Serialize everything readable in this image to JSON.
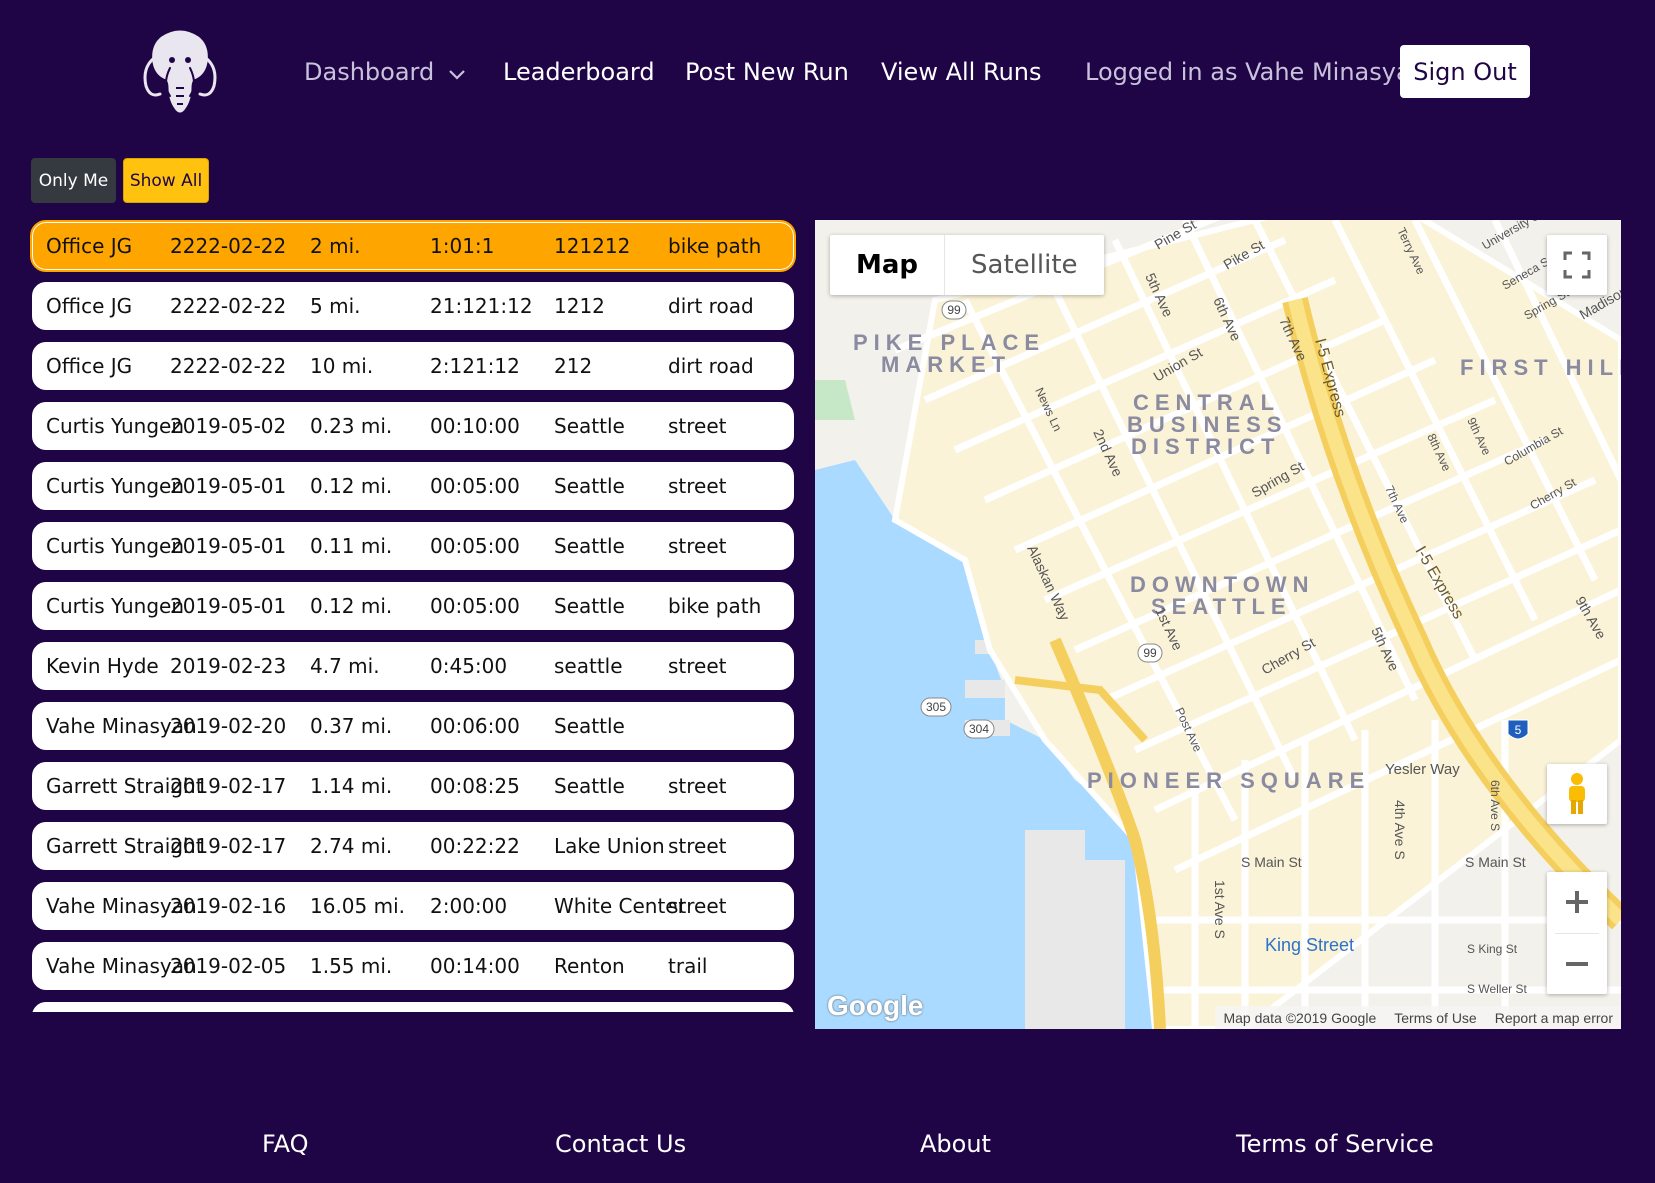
{
  "nav": {
    "logo": "mammoth-logo",
    "dashboard": "Dashboard",
    "leaderboard": "Leaderboard",
    "post_new_run": "Post New Run",
    "view_all_runs": "View All Runs",
    "logged_in": "Logged in as Vahe Minasyan",
    "sign_out": "Sign Out"
  },
  "filters": {
    "only_me": "Only Me",
    "show_all": "Show All"
  },
  "runs": [
    [
      "Office JG",
      "2222-02-22",
      "2 mi.",
      "1:01:1",
      "121212",
      "bike path"
    ],
    [
      "Office JG",
      "2222-02-22",
      "5 mi.",
      "21:121:12",
      "1212",
      "dirt road"
    ],
    [
      "Office JG",
      "2222-02-22",
      "10 mi.",
      "2:121:12",
      "212",
      "dirt road"
    ],
    [
      "Curtis Yungen",
      "2019-05-02",
      "0.23 mi.",
      "00:10:00",
      "Seattle",
      "street"
    ],
    [
      "Curtis Yungen",
      "2019-05-01",
      "0.12 mi.",
      "00:05:00",
      "Seattle",
      "street"
    ],
    [
      "Curtis Yungen",
      "2019-05-01",
      "0.11 mi.",
      "00:05:00",
      "Seattle",
      "street"
    ],
    [
      "Curtis Yungen",
      "2019-05-01",
      "0.12 mi.",
      "00:05:00",
      "Seattle",
      "bike path"
    ],
    [
      "Kevin Hyde",
      "2019-02-23",
      "4.7 mi.",
      "0:45:00",
      "seattle",
      "street"
    ],
    [
      "Vahe Minasyan",
      "2019-02-20",
      "0.37 mi.",
      "00:06:00",
      "Seattle",
      ""
    ],
    [
      "Garrett Straight",
      "2019-02-17",
      "1.14 mi.",
      "00:08:25",
      "Seattle",
      "street"
    ],
    [
      "Garrett Straight",
      "2019-02-17",
      "2.74 mi.",
      "00:22:22",
      "Lake Union",
      "street"
    ],
    [
      "Vahe Minasyan",
      "2019-02-16",
      "16.05 mi.",
      "2:00:00",
      "White Center",
      "street"
    ],
    [
      "Vahe Minasyan",
      "2019-02-05",
      "1.55 mi.",
      "00:14:00",
      "Renton",
      "trail"
    ]
  ],
  "map": {
    "type_map": "Map",
    "type_satellite": "Satellite",
    "google": "Google",
    "attribution": "Map data ©2019 Google",
    "terms": "Terms of Use",
    "report": "Report a map error",
    "districts": [
      "PIKE PLACE",
      "MARKET",
      "CENTRAL",
      "BUSINESS",
      "DISTRICT",
      "FIRST HILL",
      "DOWNTOWN",
      "SEATTLE",
      "PIONEER SQUARE"
    ],
    "streets": [
      "Pine St",
      "Pike St",
      "5th Ave",
      "6th Ave",
      "Union St",
      "7th Ave",
      "I-5 Express",
      "Spring St",
      "2nd Ave",
      "Alaskan Way",
      "1st Ave",
      "Cherry St",
      "5th Ave",
      "Yesler Way",
      "4th Ave S",
      "S Main St",
      "S Main St",
      "1st Ave S",
      "King Street",
      "S King St",
      "S Weller St",
      "I-5 Express",
      "9th Ave",
      "Terry Ave",
      "University St",
      "Seneca St",
      "Spring St",
      "8th Ave",
      "9th Ave",
      "Columbia St",
      "Cherry St",
      "7th Ave",
      "Post Ave",
      "News Ln",
      "6th Ave S",
      "Madison St"
    ],
    "route_shields": [
      "99",
      "99",
      "305",
      "304",
      "5"
    ]
  },
  "footer": {
    "faq": "FAQ",
    "contact": "Contact Us",
    "about": "About",
    "terms": "Terms of Service"
  },
  "colors": {
    "background": "#200546",
    "active_row": "#ffa500",
    "show_all": "#ffc20e",
    "only_me": "#343a40"
  }
}
